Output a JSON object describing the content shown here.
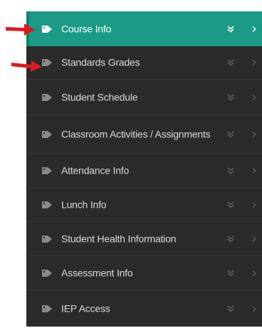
{
  "colors": {
    "panel_bg": "#2b2b2b",
    "active_bg": "#1b9b86",
    "text": "#d9d9d9",
    "arrow": "#e0191e"
  },
  "menu": {
    "items": [
      {
        "label": "Course Info",
        "icon": "tag-icon",
        "active": true
      },
      {
        "label": "Standards Grades",
        "icon": "tag-icon",
        "active": false
      },
      {
        "label": "Student Schedule",
        "icon": "tag-icon",
        "active": false
      },
      {
        "label": "Classroom Activities / Assignments",
        "icon": "tag-icon",
        "active": false
      },
      {
        "label": "Attendance Info",
        "icon": "tag-icon",
        "active": false
      },
      {
        "label": "Lunch Info",
        "icon": "tag-icon",
        "active": false
      },
      {
        "label": "Student Health Information",
        "icon": "tag-icon",
        "active": false
      },
      {
        "label": "Assessment Info",
        "icon": "tag-icon",
        "active": false
      },
      {
        "label": "IEP Access",
        "icon": "tag-icon",
        "active": false
      }
    ]
  },
  "annotations": {
    "arrows": [
      "red-arrow-icon",
      "red-arrow-icon"
    ]
  }
}
